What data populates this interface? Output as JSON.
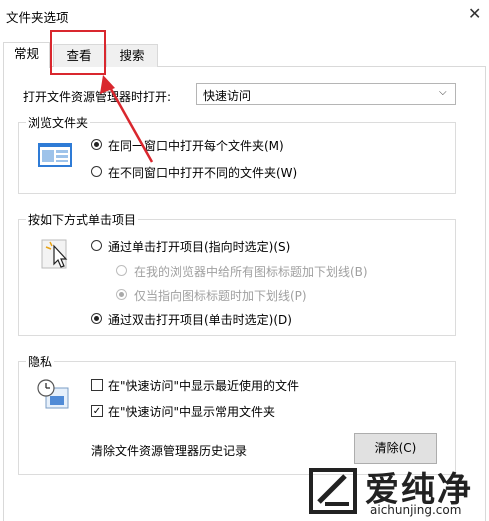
{
  "window": {
    "title": "文件夹选项",
    "close_glyph": "✕"
  },
  "tabs": [
    {
      "label": "常规",
      "active": true
    },
    {
      "label": "查看",
      "active": false
    },
    {
      "label": "搜索",
      "active": false
    }
  ],
  "highlight": {
    "target": "查看",
    "color": "#d9272e"
  },
  "opener": {
    "label": "打开文件资源管理器时打开:",
    "value": "快速访问"
  },
  "browse": {
    "title": "浏览文件夹",
    "icon": "folder-window-icon",
    "options": [
      {
        "label": "在同一窗口中打开每个文件夹(M)",
        "selected": true
      },
      {
        "label": "在不同窗口中打开不同的文件夹(W)",
        "selected": false
      }
    ]
  },
  "click": {
    "title": "按如下方式单击项目",
    "icon": "cursor-click-icon",
    "single": {
      "label": "通过单击打开项目(指向时选定)(S)",
      "selected": false
    },
    "underline_all": {
      "label": "在我的浏览器中给所有图标标题加下划线(B)",
      "selected": false,
      "disabled": true
    },
    "underline_hover": {
      "label": "仅当指向图标标题时加下划线(P)",
      "selected": true,
      "disabled": true
    },
    "double": {
      "label": "通过双击打开项目(单击时选定)(D)",
      "selected": true
    }
  },
  "privacy": {
    "title": "隐私",
    "icon": "privacy-clock-icon",
    "recent_files": {
      "label": "在\"快速访问\"中显示最近使用的文件",
      "checked": false
    },
    "frequent_folders": {
      "label": "在\"快速访问\"中显示常用文件夹",
      "checked": true
    },
    "clear_history_label": "清除文件资源管理器历史记录",
    "clear_button": "清除(C)"
  },
  "watermark": {
    "text": "爱纯净",
    "url": "aichunjing.com"
  },
  "colors": {
    "accent": "#d9272e",
    "border": "#dcdcdc",
    "button_bg": "#e1e1e1"
  }
}
